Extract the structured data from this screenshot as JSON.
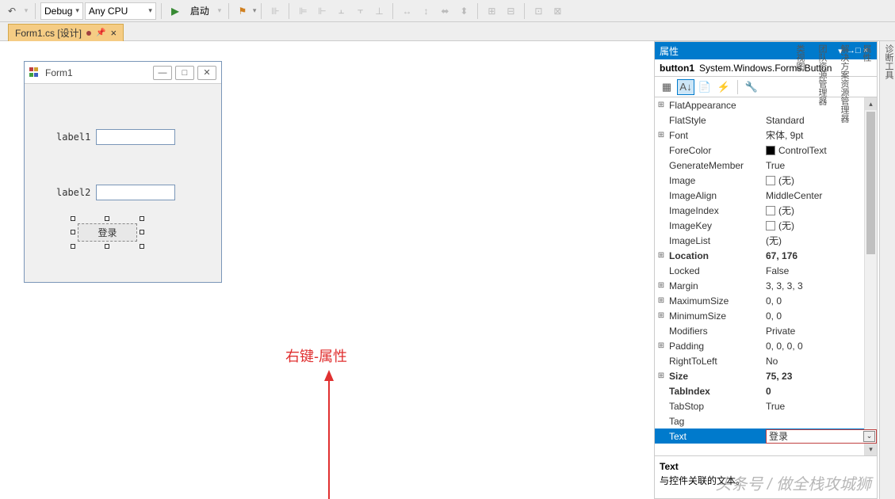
{
  "toolbar": {
    "config": "Debug",
    "platform": "Any CPU",
    "start": "启动"
  },
  "tab": {
    "label": "Form1.cs [设计]"
  },
  "form": {
    "title": "Form1",
    "label1": "label1",
    "label2": "label2",
    "button": "登录"
  },
  "annotation": "右键-属性",
  "props": {
    "title": "属性",
    "object_name": "button1",
    "object_type": "System.Windows.Forms.Button",
    "rows": [
      {
        "exp": "⊞",
        "key": "FlatAppearance",
        "val": "",
        "bold": false
      },
      {
        "exp": "",
        "key": "FlatStyle",
        "val": "Standard",
        "bold": false
      },
      {
        "exp": "⊞",
        "key": "Font",
        "val": "宋体, 9pt",
        "bold": false
      },
      {
        "exp": "",
        "key": "ForeColor",
        "val": "ControlText",
        "bold": false,
        "swatch": "black"
      },
      {
        "exp": "",
        "key": "GenerateMember",
        "val": "True",
        "bold": false
      },
      {
        "exp": "",
        "key": "Image",
        "val": "(无)",
        "bold": false,
        "swatch": "empty"
      },
      {
        "exp": "",
        "key": "ImageAlign",
        "val": "MiddleCenter",
        "bold": false
      },
      {
        "exp": "",
        "key": "ImageIndex",
        "val": "(无)",
        "bold": false,
        "swatch": "empty"
      },
      {
        "exp": "",
        "key": "ImageKey",
        "val": "(无)",
        "bold": false,
        "swatch": "empty"
      },
      {
        "exp": "",
        "key": "ImageList",
        "val": "(无)",
        "bold": false
      },
      {
        "exp": "⊞",
        "key": "Location",
        "val": "67, 176",
        "bold": true
      },
      {
        "exp": "",
        "key": "Locked",
        "val": "False",
        "bold": false
      },
      {
        "exp": "⊞",
        "key": "Margin",
        "val": "3, 3, 3, 3",
        "bold": false
      },
      {
        "exp": "⊞",
        "key": "MaximumSize",
        "val": "0, 0",
        "bold": false
      },
      {
        "exp": "⊞",
        "key": "MinimumSize",
        "val": "0, 0",
        "bold": false
      },
      {
        "exp": "",
        "key": "Modifiers",
        "val": "Private",
        "bold": false
      },
      {
        "exp": "⊞",
        "key": "Padding",
        "val": "0, 0, 0, 0",
        "bold": false
      },
      {
        "exp": "",
        "key": "RightToLeft",
        "val": "No",
        "bold": false
      },
      {
        "exp": "⊞",
        "key": "Size",
        "val": "75, 23",
        "bold": true
      },
      {
        "exp": "",
        "key": "TabIndex",
        "val": "0",
        "bold": true
      },
      {
        "exp": "",
        "key": "TabStop",
        "val": "True",
        "bold": false
      },
      {
        "exp": "",
        "key": "Tag",
        "val": "",
        "bold": false
      },
      {
        "exp": "",
        "key": "Text",
        "val": "登录",
        "bold": false,
        "selected": true
      }
    ],
    "desc_title": "Text",
    "desc_body": "与控件关联的文本。"
  },
  "rstrip": [
    "诊断工具",
    "属性",
    "解决方案资源管理器",
    "团队资源管理器",
    "类视图"
  ],
  "watermark": "头条号 / 做全栈攻城狮"
}
